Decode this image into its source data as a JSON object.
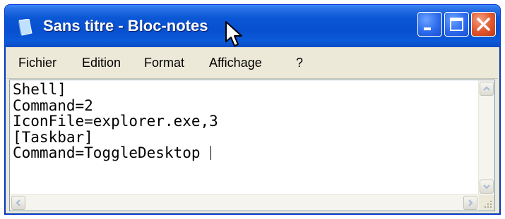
{
  "window": {
    "title": "Sans titre - Bloc-notes",
    "buttons": {
      "minimize": "minimize-icon",
      "maximize": "maximize-icon",
      "close": "close-icon"
    }
  },
  "menubar": {
    "items": [
      "Fichier",
      "Edition",
      "Format",
      "Affichage",
      "?"
    ]
  },
  "editor": {
    "lines": [
      "Shell]",
      "Command=2",
      "IconFile=explorer.exe,3",
      "[Taskbar]",
      "Command=ToggleDesktop "
    ]
  },
  "colors": {
    "titlebar": "#0a57d5",
    "close_button": "#e0552e",
    "chrome": "#ece9d8"
  }
}
